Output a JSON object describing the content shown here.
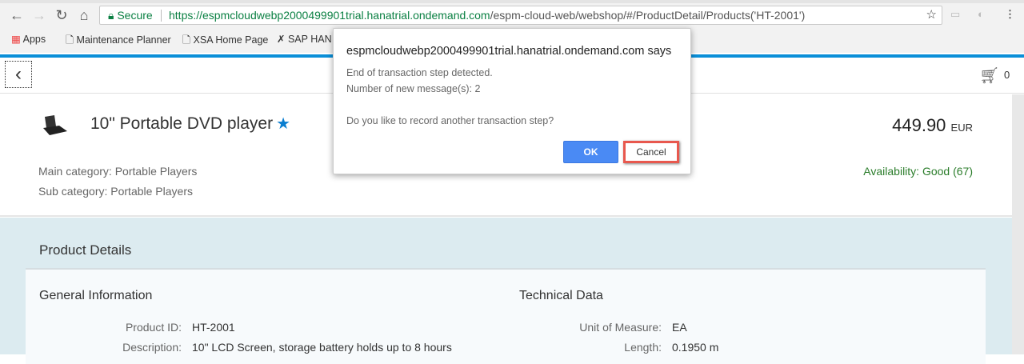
{
  "browser": {
    "secure_label": "Secure",
    "url_host": "https://espmcloudwebp2000499901trial.hanatrial.ondemand.com",
    "url_path": "/espm-cloud-web/webshop/#/ProductDetail/Products('HT-2001')",
    "bookmarks": [
      "Apps",
      "Maintenance Planner",
      "XSA Home Page",
      "SAP HAN"
    ]
  },
  "header": {
    "cart_count": "0"
  },
  "product": {
    "name": "10\" Portable DVD player",
    "main_category": "Main category: Portable Players",
    "sub_category": "Sub category: Portable Players",
    "price": "449.90",
    "currency": "EUR",
    "availability": "Availability: Good (67)"
  },
  "details": {
    "title": "Product Details",
    "general": {
      "title": "General Information",
      "fields": [
        {
          "label": "Product ID:",
          "value": "HT-2001"
        },
        {
          "label": "Description:",
          "value": "10\" LCD Screen, storage battery holds up to 8 hours"
        }
      ]
    },
    "technical": {
      "title": "Technical Data",
      "fields": [
        {
          "label": "Unit of Measure:",
          "value": "EA"
        },
        {
          "label": "Length:",
          "value": "0.1950 m"
        }
      ]
    }
  },
  "dialog": {
    "title": "espmcloudwebp2000499901trial.hanatrial.ondemand.com says",
    "line1": "End of transaction step detected.",
    "line2": "Number of new message(s): 2",
    "line3": "Do you like to record another transaction step?",
    "ok_label": "OK",
    "cancel_label": "Cancel",
    "highlight_color": "#e8584e"
  },
  "colors": {
    "accent": "#0a8fd8",
    "availability": "#2b7d2b",
    "ok_button": "#4a8af4"
  }
}
